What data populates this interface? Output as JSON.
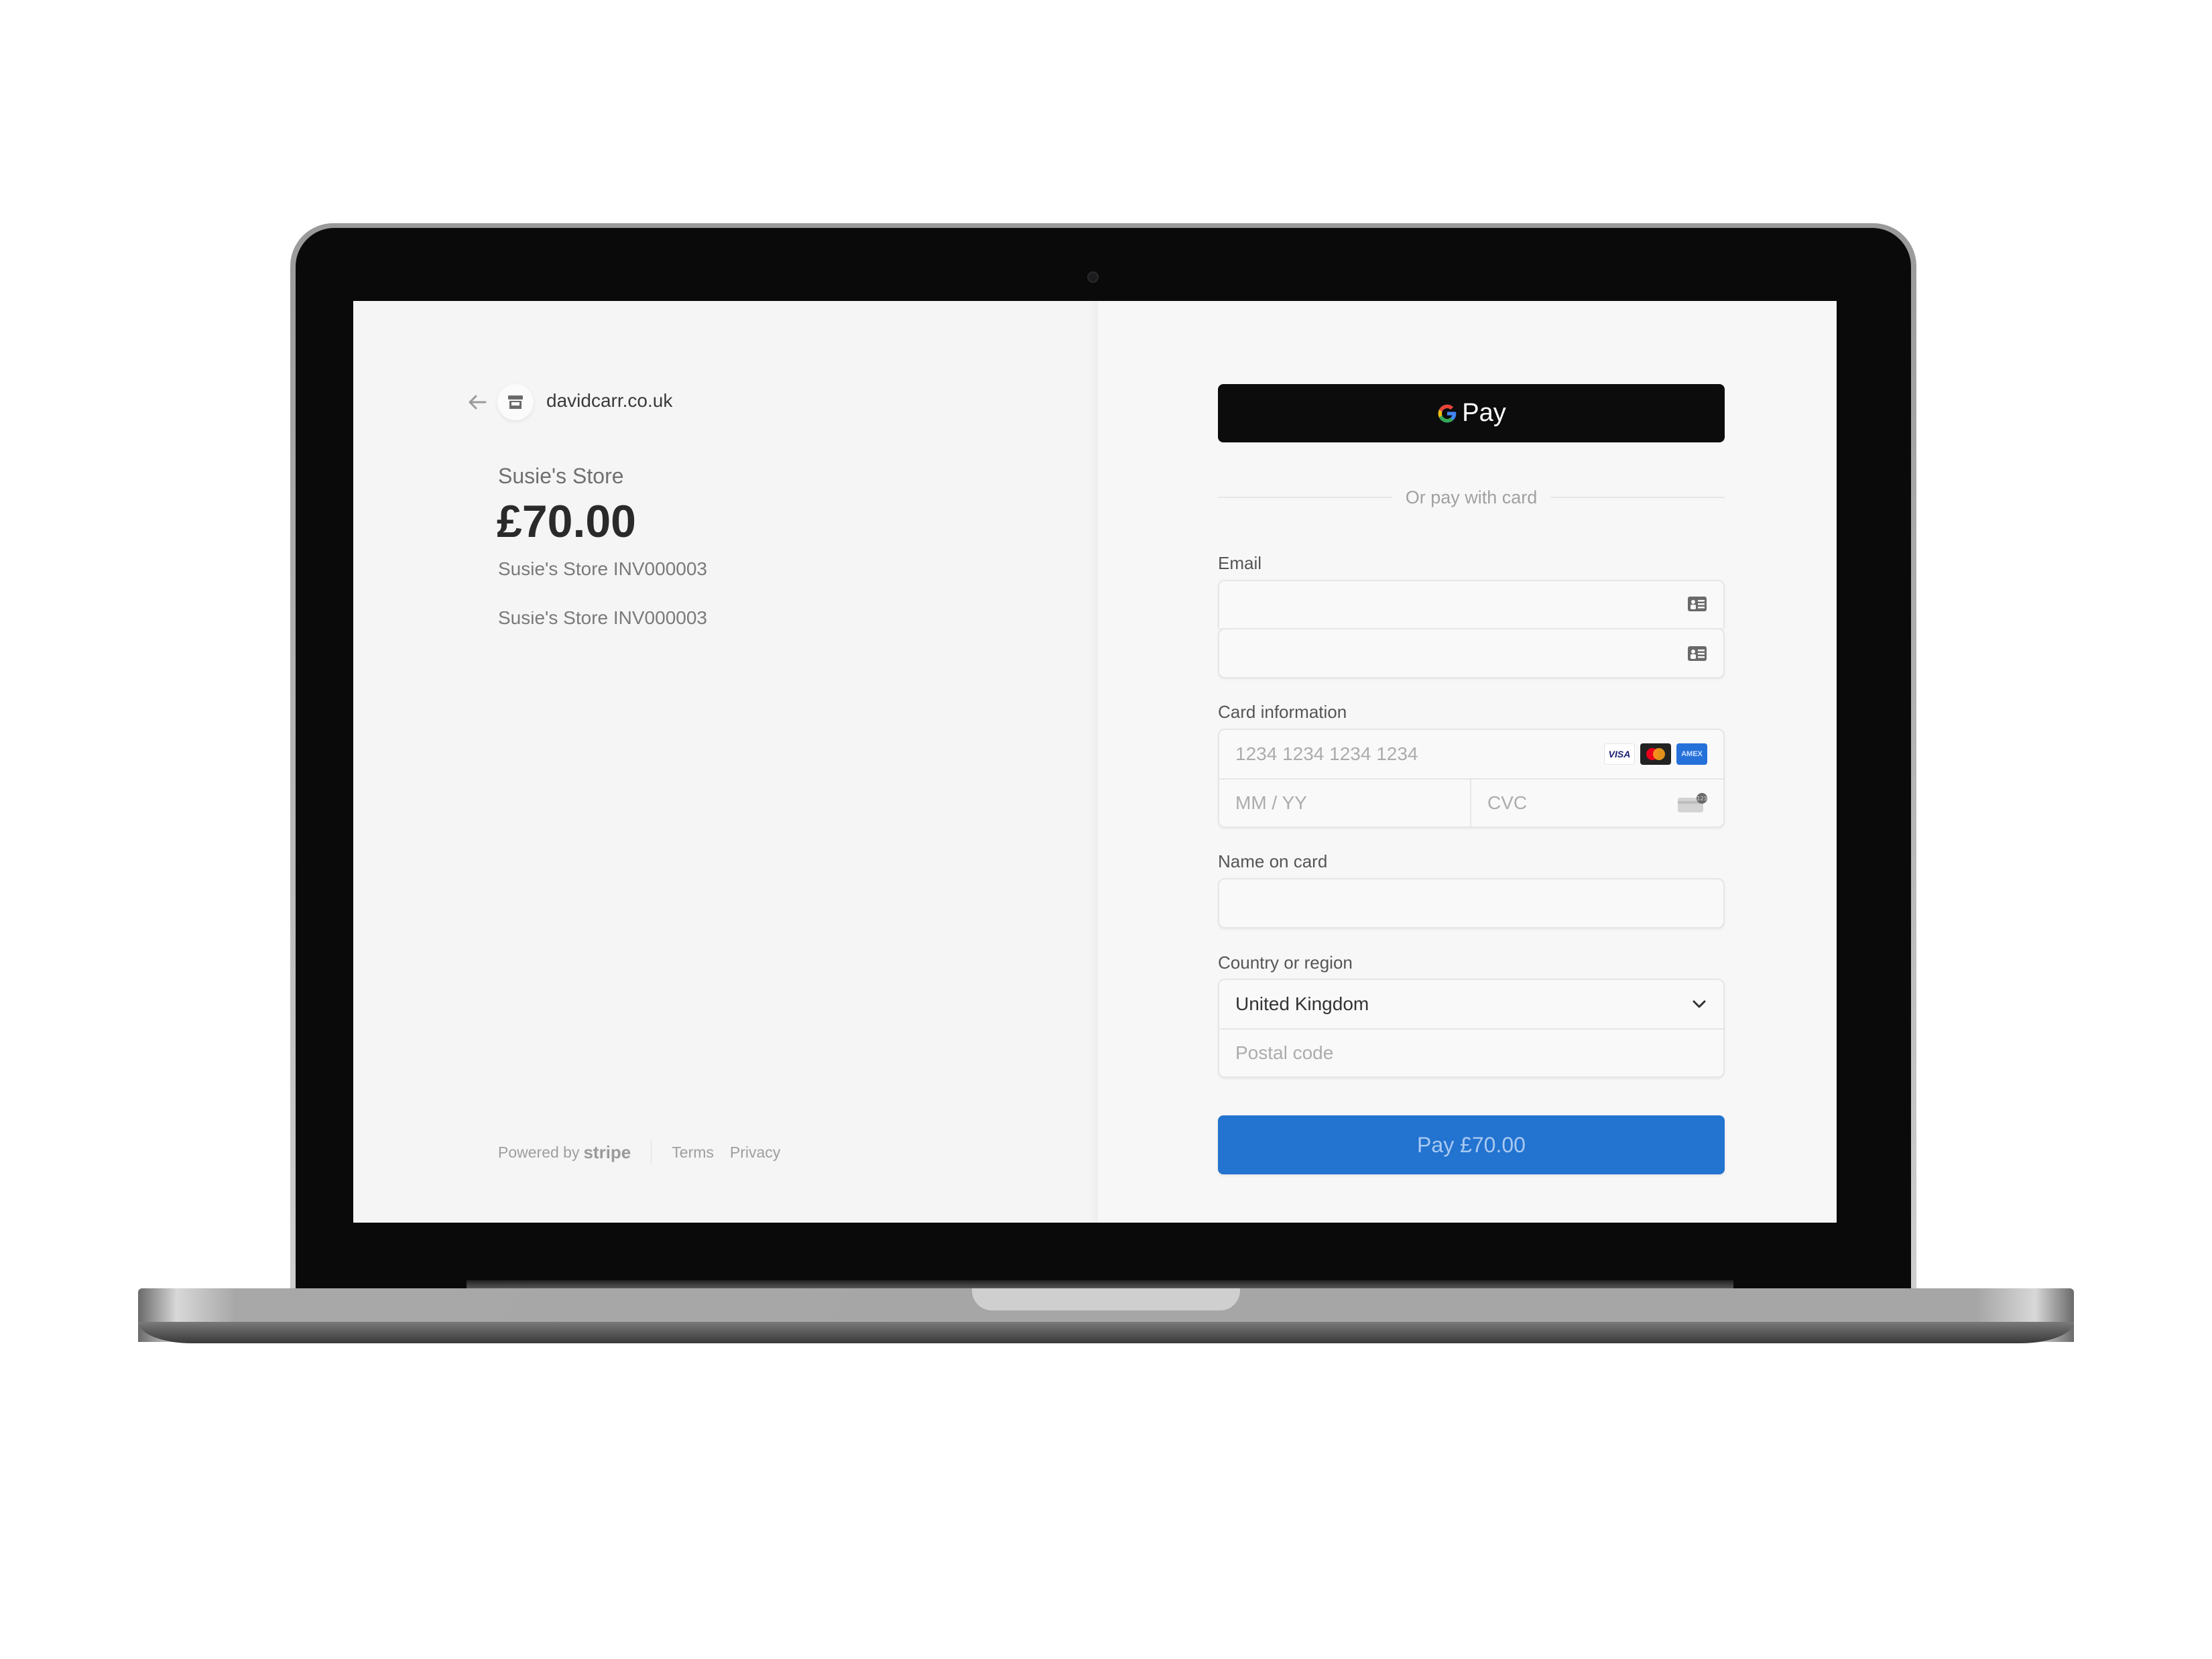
{
  "merchant_header": {
    "back_icon": "arrow-left-icon",
    "store_icon": "storefront-icon",
    "domain": "davidcarr.co.uk"
  },
  "summary": {
    "merchant_name": "Susie's Store",
    "amount": "£70.00",
    "description": "Susie's Store INV000003",
    "description_duplicate": "Susie's Store INV000003"
  },
  "footer": {
    "powered_by": "Powered by",
    "brand": "stripe",
    "terms": "Terms",
    "privacy": "Privacy"
  },
  "payment": {
    "gpay_label": "Pay",
    "gpay_icon": "google-g-icon",
    "divider_text": "Or pay with card",
    "email": {
      "label": "Email",
      "value": "",
      "icon": "contact-card-icon"
    },
    "card": {
      "label": "Card information",
      "number_placeholder": "1234 1234 1234 1234",
      "expiry_placeholder": "MM / YY",
      "cvc_placeholder": "CVC",
      "brands": [
        "VISA",
        "Mastercard",
        "AMEX"
      ],
      "cvc_icon": "card-cvc-icon"
    },
    "name": {
      "label": "Name on card",
      "value": ""
    },
    "country": {
      "label": "Country or region",
      "selected": "United Kingdom",
      "postal_placeholder": "Postal code"
    },
    "pay_button": "Pay £70.00",
    "colors": {
      "pay_button": "#2373d0",
      "gpay_button": "#0c0c0c"
    }
  }
}
